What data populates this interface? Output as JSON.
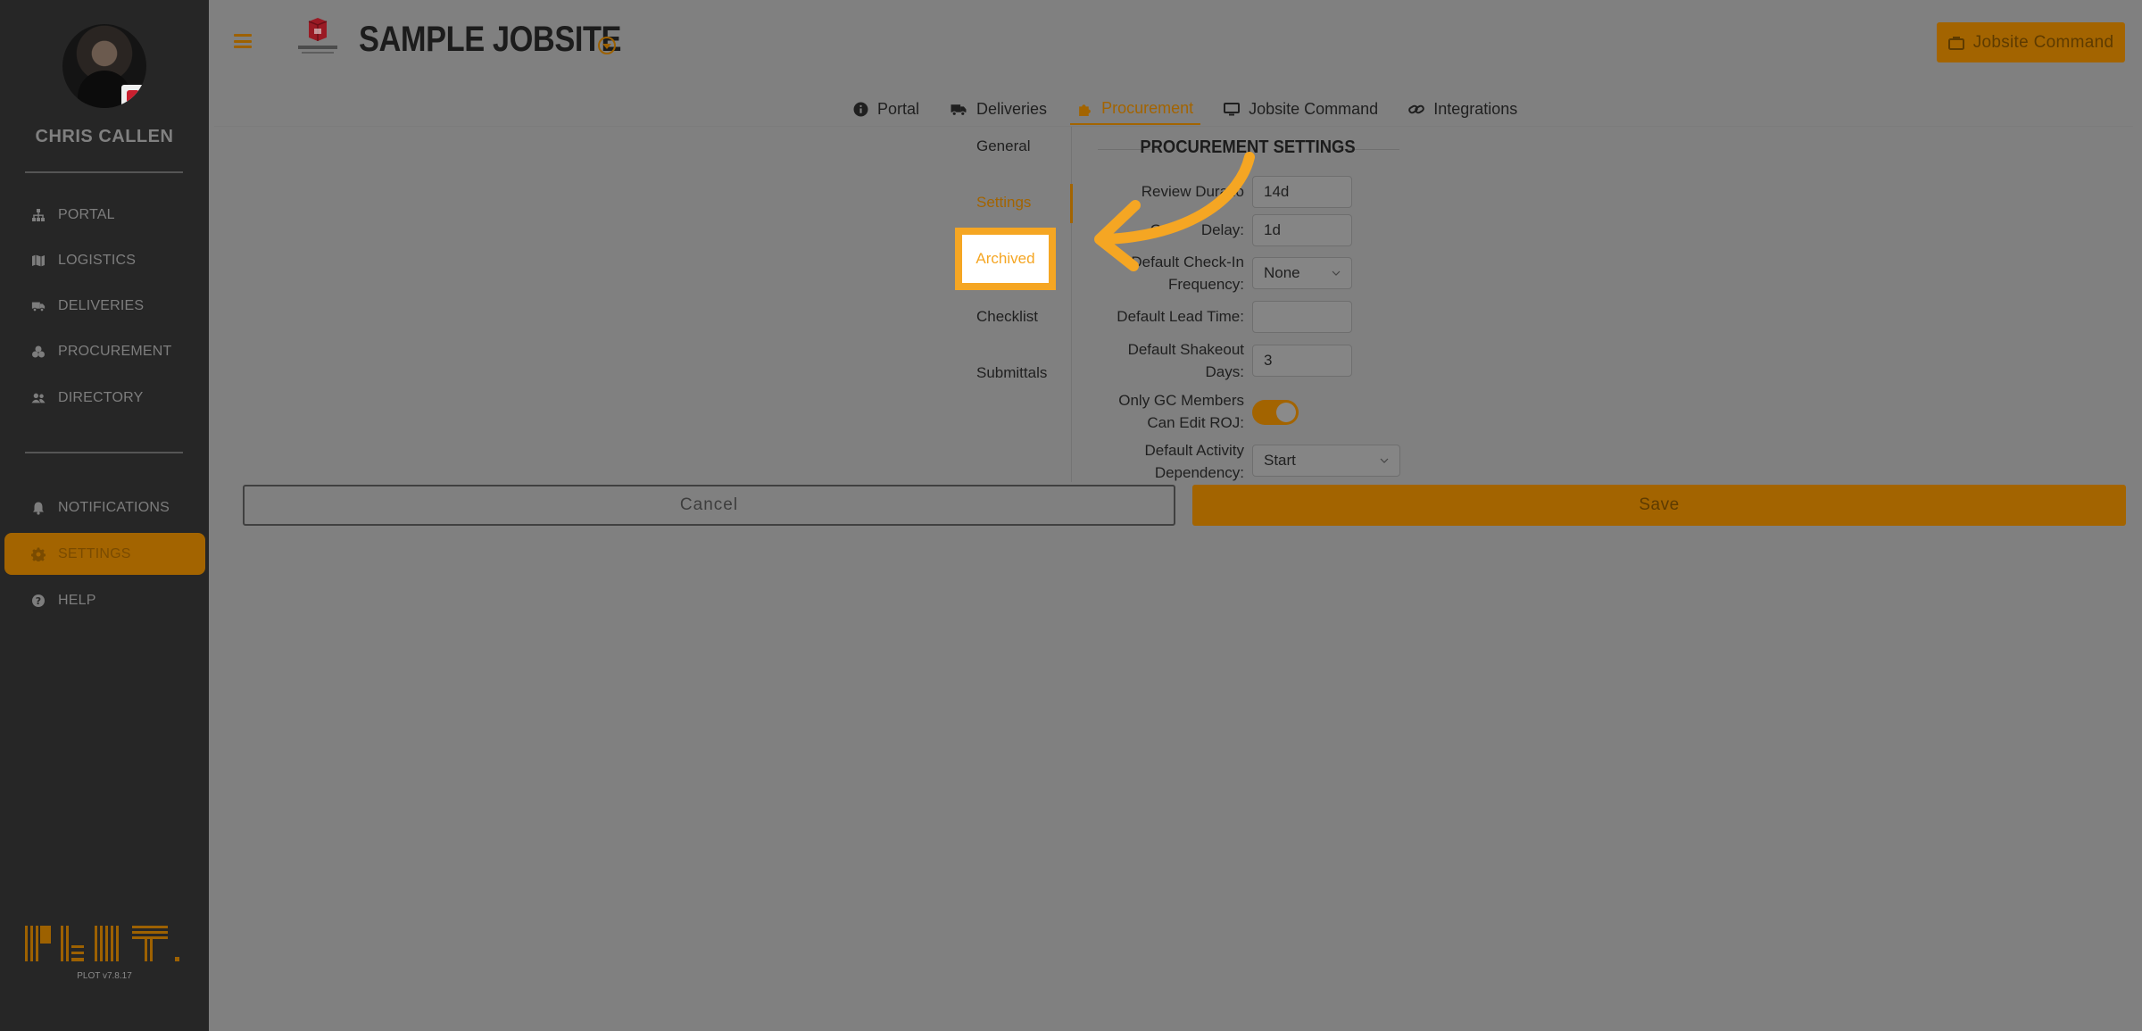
{
  "user": {
    "name": "CHRIS CALLEN"
  },
  "sidebar": {
    "primary": [
      {
        "label": "PORTAL",
        "icon": "sitemap-icon"
      },
      {
        "label": "LOGISTICS",
        "icon": "map-icon"
      },
      {
        "label": "DELIVERIES",
        "icon": "truck-icon"
      },
      {
        "label": "PROCUREMENT",
        "icon": "puzzle-icon"
      },
      {
        "label": "DIRECTORY",
        "icon": "users-icon"
      }
    ],
    "secondary": [
      {
        "label": "NOTIFICATIONS",
        "icon": "bell-icon"
      },
      {
        "label": "SETTINGS",
        "icon": "gear-icon",
        "active": true
      },
      {
        "label": "HELP",
        "icon": "question-icon"
      }
    ],
    "version": "PLOT v7.8.17"
  },
  "header": {
    "title": "SAMPLE JOBSITE",
    "command_button": "Jobsite Command"
  },
  "tabs": [
    {
      "label": "Portal",
      "icon": "info-icon"
    },
    {
      "label": "Deliveries",
      "icon": "truck-icon"
    },
    {
      "label": "Procurement",
      "icon": "puzzle-icon",
      "active": true
    },
    {
      "label": "Jobsite Command",
      "icon": "monitor-icon"
    },
    {
      "label": "Integrations",
      "icon": "link-icon"
    }
  ],
  "subnav": {
    "items": [
      "General",
      "Settings",
      "Archived",
      "Checklist",
      "Submittals"
    ],
    "active": "Settings",
    "highlighted": "Archived"
  },
  "settings": {
    "title": "PROCUREMENT SETTINGS",
    "review_duration": {
      "label": "Review Duratio",
      "value": "14d"
    },
    "order_delay": {
      "label": "Delay:",
      "label_prefix": "O",
      "value": "1d"
    },
    "check_in": {
      "label_1": "Default Check-In",
      "label_2": "Frequency:",
      "value": "None"
    },
    "lead_time": {
      "label": "Default Lead Time:",
      "value": ""
    },
    "shakeout": {
      "label_1": "Default Shakeout",
      "label_2": "Days:",
      "value": "3"
    },
    "gc_edit": {
      "label_1": "Only GC Members",
      "label_2": "Can Edit ROJ:",
      "enabled": true
    },
    "activity_dependency": {
      "label_1": "Default Activity",
      "label_2": "Dependency:",
      "value": "Start"
    }
  },
  "actions": {
    "cancel": "Cancel",
    "save": "Save"
  },
  "colors": {
    "accent": "#a36400",
    "highlight": "#f5a623",
    "sidebar": "#262626",
    "overlay": "#808080"
  }
}
